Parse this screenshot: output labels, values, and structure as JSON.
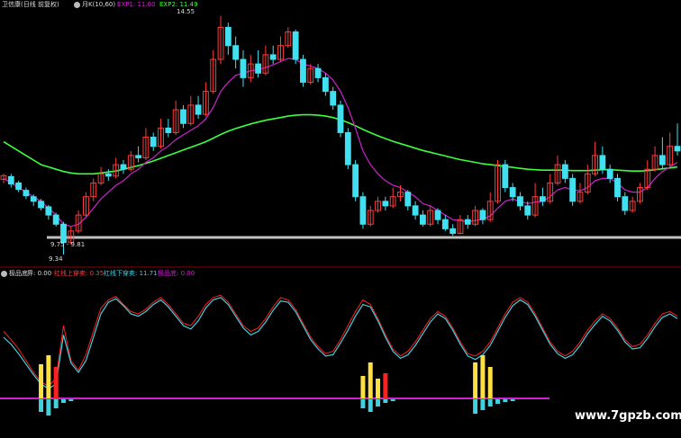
{
  "top_legend": {
    "title": "卫信康(日线 前复权)",
    "indicator": "月K(10,60)",
    "ema1_label": "EXP1: 11.60",
    "ema2_label": "EXP2: 11.49"
  },
  "bottom_legend": {
    "title": "极品底",
    "field1": "界: 0.00",
    "field2": "红线上穿卖: 0.35",
    "field3": "红线下穿卖: 11.71",
    "field4": "极品底: 0.00"
  },
  "annotations": {
    "high_label": "14.55",
    "low_label": "9.34",
    "range_label": "9.75 - 9.81"
  },
  "watermark": "www.7gpzb.com",
  "colors": {
    "background": "#000000",
    "up": "#ff3b3b",
    "down": "#40e0f0",
    "ema_long": "#3cff3c",
    "ema_short": "#d020d0",
    "osc_red": "#ff2020",
    "osc_cyan": "#40d0e0",
    "yellow_bar": "#ffe040",
    "divider": "#8b0000"
  },
  "chart_data": {
    "type": "candlestick",
    "y_range": [
      9.2,
      14.7
    ],
    "candles": [
      [
        10.98,
        11.06,
        10.9,
        11.1
      ],
      [
        11.04,
        10.88,
        10.8,
        11.1
      ],
      [
        10.9,
        10.76,
        10.7,
        10.95
      ],
      [
        10.74,
        10.62,
        10.55,
        10.8
      ],
      [
        10.6,
        10.5,
        10.4,
        10.65
      ],
      [
        10.5,
        10.36,
        10.3,
        10.55
      ],
      [
        10.38,
        10.2,
        10.1,
        10.42
      ],
      [
        10.2,
        10.0,
        9.95,
        10.25
      ],
      [
        10.0,
        9.6,
        9.34,
        10.05
      ],
      [
        9.6,
        9.85,
        9.55,
        9.95
      ],
      [
        9.85,
        10.2,
        9.8,
        10.3
      ],
      [
        10.2,
        10.6,
        10.15,
        10.7
      ],
      [
        10.6,
        10.9,
        10.5,
        11.0
      ],
      [
        10.9,
        11.1,
        10.85,
        11.25
      ],
      [
        11.1,
        11.05,
        10.95,
        11.2
      ],
      [
        11.05,
        11.3,
        11.0,
        11.45
      ],
      [
        11.3,
        11.2,
        11.1,
        11.4
      ],
      [
        11.2,
        11.5,
        11.15,
        11.6
      ],
      [
        11.5,
        11.45,
        11.35,
        11.7
      ],
      [
        11.45,
        11.9,
        11.4,
        12.1
      ],
      [
        11.9,
        11.7,
        11.6,
        12.0
      ],
      [
        11.7,
        12.1,
        11.65,
        12.3
      ],
      [
        12.1,
        12.0,
        11.9,
        12.3
      ],
      [
        12.0,
        12.5,
        11.95,
        12.7
      ],
      [
        12.5,
        12.2,
        12.1,
        12.6
      ],
      [
        12.2,
        12.6,
        12.15,
        12.8
      ],
      [
        12.6,
        12.4,
        12.3,
        12.8
      ],
      [
        12.4,
        12.9,
        12.35,
        13.1
      ],
      [
        12.9,
        13.6,
        12.85,
        13.8
      ],
      [
        13.6,
        14.3,
        13.5,
        14.55
      ],
      [
        14.3,
        13.9,
        13.7,
        14.4
      ],
      [
        13.9,
        13.6,
        13.4,
        14.1
      ],
      [
        13.6,
        13.2,
        13.0,
        13.8
      ],
      [
        13.2,
        13.5,
        13.1,
        13.7
      ],
      [
        13.5,
        13.3,
        13.2,
        13.8
      ],
      [
        13.3,
        13.7,
        13.25,
        13.9
      ],
      [
        13.7,
        13.6,
        13.5,
        13.9
      ],
      [
        13.6,
        13.9,
        13.55,
        14.1
      ],
      [
        13.9,
        14.2,
        13.85,
        14.3
      ],
      [
        14.2,
        13.6,
        13.5,
        14.25
      ],
      [
        13.6,
        13.1,
        13.0,
        13.7
      ],
      [
        13.1,
        13.4,
        13.05,
        13.5
      ],
      [
        13.4,
        13.2,
        13.1,
        13.5
      ],
      [
        13.2,
        12.9,
        12.8,
        13.3
      ],
      [
        12.9,
        12.6,
        12.5,
        13.0
      ],
      [
        12.6,
        12.0,
        11.9,
        12.7
      ],
      [
        12.0,
        11.3,
        11.2,
        12.1
      ],
      [
        11.3,
        10.6,
        10.5,
        11.4
      ],
      [
        10.6,
        10.0,
        9.9,
        10.7
      ],
      [
        10.0,
        10.3,
        9.95,
        10.4
      ],
      [
        10.3,
        10.5,
        10.25,
        10.6
      ],
      [
        10.5,
        10.4,
        10.3,
        10.6
      ],
      [
        10.4,
        10.6,
        10.35,
        10.8
      ],
      [
        10.6,
        10.7,
        10.5,
        10.85
      ],
      [
        10.7,
        10.4,
        10.3,
        10.75
      ],
      [
        10.4,
        10.2,
        10.1,
        10.5
      ],
      [
        10.2,
        10.0,
        9.95,
        10.3
      ],
      [
        10.0,
        10.3,
        9.95,
        10.4
      ],
      [
        10.3,
        10.1,
        10.0,
        10.35
      ],
      [
        10.1,
        9.9,
        9.85,
        10.2
      ],
      [
        9.9,
        9.8,
        9.75,
        10.0
      ],
      [
        9.8,
        10.1,
        9.78,
        10.2
      ],
      [
        10.1,
        10.0,
        9.9,
        10.2
      ],
      [
        10.0,
        10.3,
        9.95,
        10.4
      ],
      [
        10.3,
        10.1,
        10.0,
        10.35
      ],
      [
        10.1,
        10.5,
        10.05,
        10.7
      ],
      [
        10.5,
        11.3,
        10.45,
        11.4
      ],
      [
        11.3,
        10.8,
        10.7,
        11.4
      ],
      [
        10.8,
        10.6,
        10.5,
        10.9
      ],
      [
        10.6,
        10.4,
        10.3,
        10.7
      ],
      [
        10.4,
        10.2,
        10.1,
        10.5
      ],
      [
        10.2,
        10.6,
        10.15,
        10.9
      ],
      [
        10.6,
        10.5,
        10.4,
        10.8
      ],
      [
        10.5,
        10.9,
        10.45,
        11.1
      ],
      [
        10.9,
        11.3,
        10.85,
        11.5
      ],
      [
        11.3,
        11.0,
        10.9,
        11.4
      ],
      [
        11.0,
        10.5,
        10.4,
        11.1
      ],
      [
        10.5,
        10.7,
        10.45,
        10.9
      ],
      [
        10.7,
        11.1,
        10.65,
        11.3
      ],
      [
        11.1,
        11.5,
        11.05,
        11.8
      ],
      [
        11.5,
        11.2,
        11.1,
        11.7
      ],
      [
        11.2,
        11.0,
        10.9,
        11.3
      ],
      [
        11.0,
        10.6,
        10.5,
        11.1
      ],
      [
        10.6,
        10.3,
        10.2,
        10.7
      ],
      [
        10.3,
        10.5,
        10.25,
        10.6
      ],
      [
        10.5,
        10.8,
        10.45,
        10.9
      ],
      [
        10.8,
        11.2,
        10.75,
        11.4
      ],
      [
        11.2,
        11.5,
        11.15,
        11.7
      ],
      [
        11.5,
        11.3,
        11.2,
        11.9
      ],
      [
        11.3,
        11.7,
        11.25,
        12.0
      ],
      [
        11.7,
        11.6,
        11.5,
        12.2
      ]
    ],
    "ema_long": [
      11.8,
      11.7,
      11.6,
      11.5,
      11.4,
      11.3,
      11.25,
      11.2,
      11.15,
      11.12,
      11.1,
      11.1,
      11.1,
      11.12,
      11.14,
      11.16,
      11.2,
      11.24,
      11.28,
      11.33,
      11.38,
      11.44,
      11.5,
      11.56,
      11.62,
      11.68,
      11.74,
      11.8,
      11.88,
      11.96,
      12.03,
      12.09,
      12.14,
      12.19,
      12.23,
      12.27,
      12.3,
      12.33,
      12.36,
      12.38,
      12.39,
      12.39,
      12.38,
      12.36,
      12.33,
      12.28,
      12.22,
      12.15,
      12.07,
      12.0,
      11.93,
      11.87,
      11.81,
      11.76,
      11.71,
      11.66,
      11.61,
      11.57,
      11.53,
      11.49,
      11.45,
      11.41,
      11.38,
      11.35,
      11.32,
      11.3,
      11.28,
      11.26,
      11.24,
      11.22,
      11.2,
      11.19,
      11.18,
      11.18,
      11.18,
      11.18,
      11.17,
      11.17,
      11.17,
      11.18,
      11.19,
      11.19,
      11.18,
      11.17,
      11.16,
      11.16,
      11.17,
      11.19,
      11.21,
      11.23,
      11.25
    ],
    "ema_short": [
      11.0,
      10.9,
      10.8,
      10.7,
      10.6,
      10.5,
      10.35,
      10.2,
      10.0,
      9.95,
      10.0,
      10.15,
      10.35,
      10.55,
      10.7,
      10.85,
      10.95,
      11.1,
      11.2,
      11.35,
      11.45,
      11.6,
      11.7,
      11.85,
      11.95,
      12.05,
      12.15,
      12.3,
      12.55,
      12.9,
      13.1,
      13.25,
      13.3,
      13.35,
      13.38,
      13.42,
      13.48,
      13.55,
      13.62,
      13.6,
      13.5,
      13.45,
      13.4,
      13.3,
      13.15,
      12.9,
      12.55,
      12.1,
      11.6,
      11.3,
      11.1,
      10.95,
      10.85,
      10.8,
      10.7,
      10.6,
      10.45,
      10.4,
      10.3,
      10.2,
      10.1,
      10.08,
      10.05,
      10.08,
      10.1,
      10.18,
      10.35,
      10.5,
      10.55,
      10.5,
      10.45,
      10.48,
      10.5,
      10.6,
      10.75,
      10.8,
      10.75,
      10.73,
      10.8,
      10.95,
      11.0,
      11.0,
      10.9,
      10.75,
      10.7,
      10.7,
      10.8,
      11.0,
      11.15,
      11.25,
      11.35
    ],
    "osc_red": [
      55,
      48,
      40,
      30,
      20,
      12,
      8,
      15,
      60,
      30,
      22,
      35,
      55,
      75,
      82,
      85,
      78,
      72,
      70,
      74,
      80,
      84,
      78,
      70,
      62,
      60,
      68,
      78,
      84,
      86,
      80,
      70,
      60,
      55,
      58,
      66,
      76,
      84,
      82,
      74,
      62,
      50,
      42,
      36,
      38,
      48,
      60,
      72,
      82,
      78,
      66,
      52,
      40,
      34,
      38,
      46,
      56,
      66,
      72,
      68,
      58,
      46,
      36,
      34,
      38,
      46,
      58,
      70,
      80,
      84,
      80,
      70,
      58,
      46,
      38,
      34,
      38,
      46,
      56,
      64,
      70,
      66,
      58,
      48,
      42,
      44,
      52,
      62,
      70,
      72,
      68
    ],
    "osc_cyan": [
      50,
      44,
      36,
      27,
      18,
      10,
      6,
      10,
      52,
      28,
      20,
      30,
      50,
      70,
      80,
      83,
      77,
      70,
      68,
      72,
      78,
      82,
      76,
      68,
      60,
      57,
      64,
      75,
      82,
      84,
      78,
      68,
      58,
      52,
      55,
      63,
      73,
      81,
      80,
      72,
      60,
      48,
      40,
      34,
      35,
      45,
      56,
      68,
      78,
      76,
      64,
      50,
      38,
      32,
      35,
      43,
      53,
      63,
      70,
      66,
      56,
      44,
      34,
      31,
      35,
      43,
      55,
      67,
      77,
      82,
      78,
      68,
      56,
      44,
      36,
      32,
      35,
      43,
      53,
      61,
      68,
      64,
      56,
      46,
      40,
      41,
      49,
      59,
      67,
      70,
      66
    ],
    "yellow_bars": [
      [
        5,
        38
      ],
      [
        6,
        48
      ],
      [
        48,
        25
      ],
      [
        49,
        40
      ],
      [
        50,
        22
      ],
      [
        63,
        40
      ],
      [
        64,
        48
      ],
      [
        65,
        35
      ]
    ],
    "red_bars": [
      [
        7,
        35
      ],
      [
        51,
        28
      ]
    ],
    "cyan_bars": [
      [
        5,
        14
      ],
      [
        6,
        18
      ],
      [
        7,
        10
      ],
      [
        8,
        4
      ],
      [
        9,
        2
      ],
      [
        48,
        10
      ],
      [
        49,
        14
      ],
      [
        50,
        8
      ],
      [
        51,
        4
      ],
      [
        52,
        2
      ],
      [
        63,
        16
      ],
      [
        64,
        12
      ],
      [
        65,
        8
      ],
      [
        66,
        5
      ],
      [
        67,
        3
      ],
      [
        68,
        2
      ]
    ]
  }
}
